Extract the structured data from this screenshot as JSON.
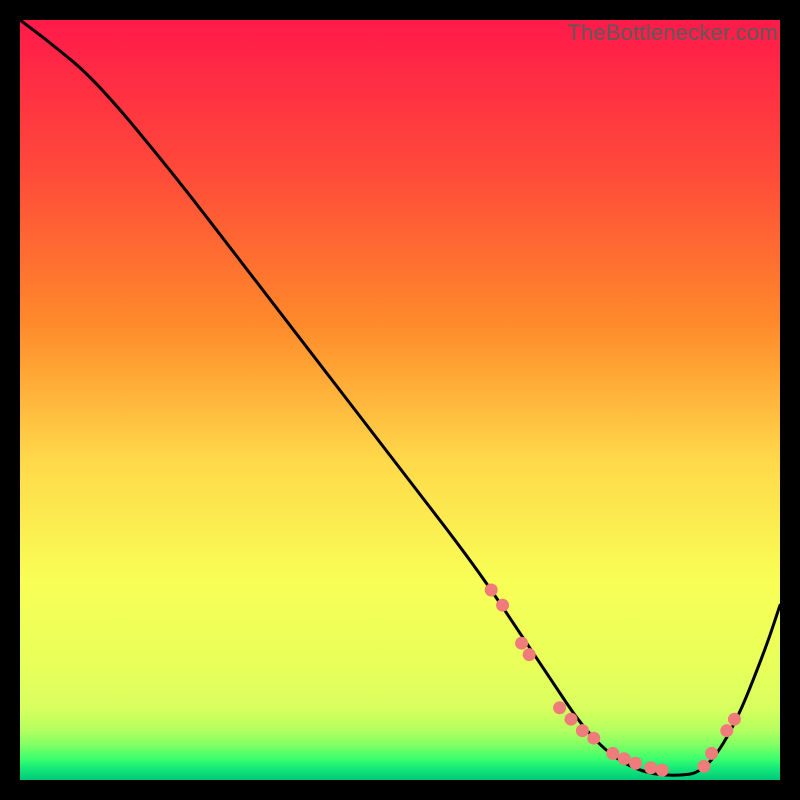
{
  "watermark": "TheBottlenecker.com",
  "colors": {
    "bg_black": "#000000",
    "curve": "#000000",
    "dot_fill": "#ef7b7b",
    "dot_stroke": "#c94f4f",
    "grad_top": "#ff1a4a",
    "grad_mid_upper": "#ff8a2a",
    "grad_mid": "#ffd94a",
    "grad_mid_lower": "#f8ff56",
    "grad_lower": "#d8ff5e",
    "grad_green1": "#9cff60",
    "grad_green2": "#2eff71",
    "grad_green3": "#00e07a"
  },
  "chart_data": {
    "type": "line",
    "title": "",
    "xlabel": "",
    "ylabel": "",
    "xlim": [
      0,
      100
    ],
    "ylim": [
      0,
      100
    ],
    "series": [
      {
        "name": "bottleneck-curve",
        "x": [
          0,
          4,
          10,
          20,
          30,
          40,
          50,
          60,
          66,
          70,
          74,
          78,
          82,
          86,
          90,
          94,
          98,
          100
        ],
        "y": [
          100,
          97,
          92,
          80,
          67,
          54,
          41,
          28,
          19,
          13,
          7,
          3,
          1,
          0.5,
          1,
          7,
          17,
          23
        ]
      }
    ],
    "markers": {
      "name": "highlight-dots",
      "x": [
        62,
        63.5,
        66,
        67,
        71,
        72.5,
        74,
        75.5,
        78,
        79.5,
        81,
        83,
        84.5,
        90,
        91,
        93,
        94
      ],
      "y": [
        25,
        23,
        18,
        16.5,
        9.5,
        8,
        6.5,
        5.5,
        3.5,
        2.8,
        2.2,
        1.6,
        1.3,
        1.8,
        3.5,
        6.5,
        8
      ]
    }
  }
}
